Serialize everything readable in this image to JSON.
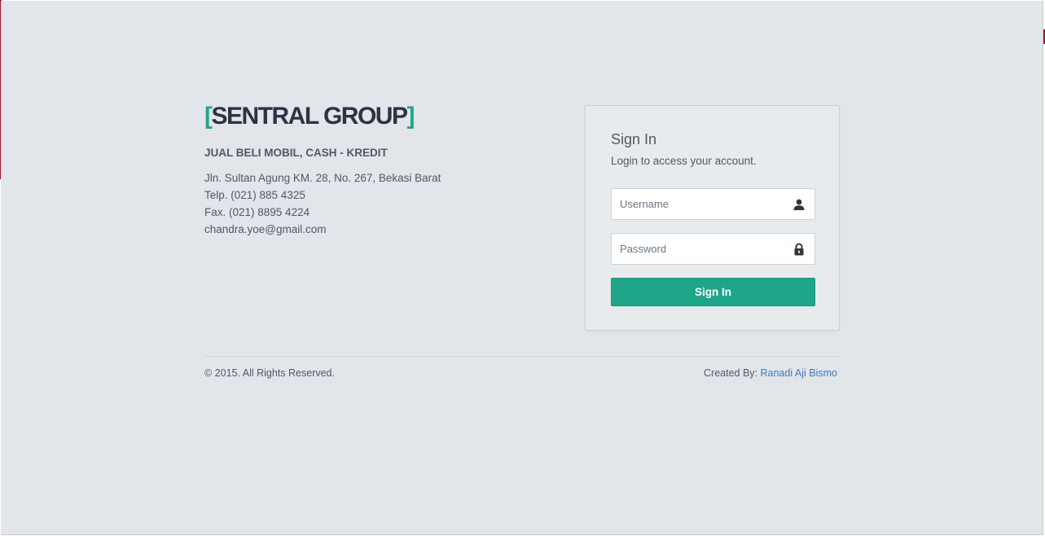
{
  "brand": {
    "bracket_open": "[",
    "name": "SENTRAL GROUP",
    "bracket_close": "]",
    "tagline": "JUAL BELI MOBIL, CASH - KREDIT",
    "address": "Jln. Sultan Agung KM. 28, No. 267, Bekasi Barat",
    "phone": "Telp. (021) 885 4325",
    "fax": "Fax. (021) 8895 4224",
    "email": "chandra.yoe@gmail.com"
  },
  "signin": {
    "title": "Sign In",
    "subtitle": "Login to access your account.",
    "username_placeholder": "Username",
    "username_value": "",
    "username_icon": "user-icon",
    "password_placeholder": "Password",
    "password_value": "",
    "password_icon": "lock-icon",
    "button_label": "Sign In"
  },
  "footer": {
    "copyright": "© 2015. All Rights Reserved.",
    "created_by_label": "Created By:",
    "author": "Ranadi Aji Bismo"
  },
  "colors": {
    "background": "#e2e5e9",
    "accent": "#1fa68a",
    "text": "#4f5966",
    "heading": "#2a3443",
    "link": "#3a7bc1"
  }
}
